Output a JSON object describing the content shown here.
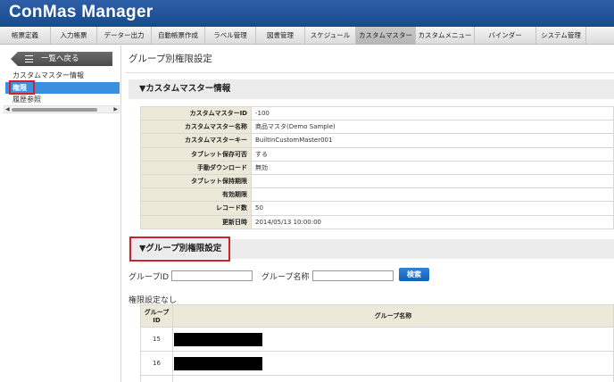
{
  "app": {
    "title": "ConMas Manager"
  },
  "tabs": [
    {
      "label": "帳票定義",
      "active": false
    },
    {
      "label": "入力帳票",
      "active": false
    },
    {
      "label": "データー出力",
      "active": false
    },
    {
      "label": "自動帳票作成",
      "active": false
    },
    {
      "label": "ラベル管理",
      "active": false
    },
    {
      "label": "図書管理",
      "active": false
    },
    {
      "label": "スケジュール",
      "active": false
    },
    {
      "label": "カスタムマスター",
      "active": true
    },
    {
      "label": "カスタムメニュー",
      "active": false
    },
    {
      "label": "バインダー",
      "active": false
    },
    {
      "label": "システム管理",
      "active": false
    }
  ],
  "sidebar": {
    "back_label": "一覧へ戻る",
    "items": [
      {
        "label": "カスタムマスター情報",
        "selected": false
      },
      {
        "label": "権限",
        "selected": true
      },
      {
        "label": "履歴参照",
        "selected": false
      }
    ]
  },
  "page": {
    "title": "グループ別権限設定"
  },
  "sections": {
    "master_info": "▼カスタムマスター情報",
    "group_perm": "▼グループ別権限設定"
  },
  "info_rows": [
    {
      "key": "カスタムマスターID",
      "value": "-100"
    },
    {
      "key": "カスタムマスター名称",
      "value": "商品マスタ(Demo Sample)"
    },
    {
      "key": "カスタムマスターキー",
      "value": "BuiltInCustomMaster001"
    },
    {
      "key": "タブレット保存可否",
      "value": "する"
    },
    {
      "key": "手動ダウンロード",
      "value": "無効"
    },
    {
      "key": "タブレット保持期限",
      "value": ""
    },
    {
      "key": "有効期限",
      "value": ""
    },
    {
      "key": "レコード数",
      "value": "50"
    },
    {
      "key": "更新日時",
      "value": "2014/05/13 10:00:00"
    }
  ],
  "search": {
    "group_id_label": "グループID",
    "group_id_value": "",
    "group_name_label": "グループ名称",
    "group_name_value": "",
    "button_label": "検索"
  },
  "perm_none_label": "権限設定なし",
  "groups_table": {
    "headers": {
      "id_line1": "グループ",
      "id_line2": "ID",
      "name": "グループ名称"
    },
    "rows": [
      {
        "id": "15"
      },
      {
        "id": "16"
      }
    ]
  },
  "colors": {
    "titlebar": "#1f4f93",
    "accent": "#3a8fe0",
    "highlight": "#d0202a",
    "table_key_bg": "#ece9d8"
  }
}
